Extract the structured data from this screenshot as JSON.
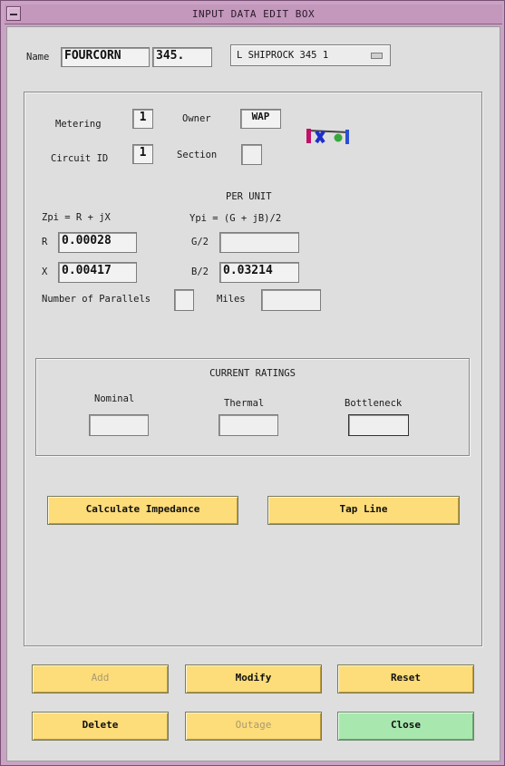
{
  "window": {
    "title": "INPUT DATA EDIT BOX"
  },
  "name_row": {
    "label": "Name",
    "name_value": "FOURCORN",
    "kv_value": "345.",
    "dropdown_value": "L  SHIPROCK 345 1"
  },
  "info": {
    "metering_label": "Metering",
    "metering_value": "1",
    "owner_label": "Owner",
    "owner_value": "WAP",
    "circuit_label": "Circuit ID",
    "circuit_value": "1",
    "section_label": "Section",
    "section_value": ""
  },
  "impedance": {
    "per_unit_label": "PER UNIT",
    "zpi_formula": "Zpi = R + jX",
    "ypi_formula": "Ypi = (G + jB)/2",
    "r_label": "R",
    "r_value": "0.00028",
    "x_label": "X",
    "x_value": "0.00417",
    "g2_label": "G/2",
    "g2_value": "",
    "b2_label": "B/2",
    "b2_value": "0.03214",
    "parallels_label": "Number of Parallels",
    "parallels_value": "",
    "miles_label": "Miles",
    "miles_value": ""
  },
  "ratings": {
    "title": "CURRENT RATINGS",
    "nominal_label": "Nominal",
    "nominal_value": "",
    "thermal_label": "Thermal",
    "thermal_value": "",
    "bottleneck_label": "Bottleneck",
    "bottleneck_value": ""
  },
  "actions": {
    "calculate_label": "Calculate Impedance",
    "tap_label": "Tap Line"
  },
  "footer": {
    "add_label": "Add",
    "modify_label": "Modify",
    "reset_label": "Reset",
    "delete_label": "Delete",
    "outage_label": "Outage",
    "close_label": "Close"
  },
  "colors": {
    "window_frame": "#c9a3c4",
    "panel_bg": "#dedede",
    "button_yellow": "#fddc7a",
    "button_green": "#a8e8ae"
  },
  "icons": [
    "window-menu-icon",
    "dropdown-indicator-icon",
    "network-line-icon"
  ]
}
